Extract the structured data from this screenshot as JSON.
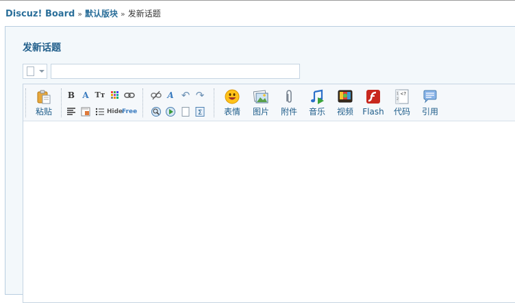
{
  "breadcrumb": {
    "home": "Discuz! Board",
    "separator": "»",
    "forum": "默认版块",
    "current": "发新话题"
  },
  "page": {
    "title": "发新话题"
  },
  "form": {
    "subject_placeholder": "",
    "subject_value": ""
  },
  "toolbar": {
    "paste_label": "粘贴",
    "hide_label": "Hide",
    "free_label": "Free",
    "smilies_label": "表情",
    "image_label": "图片",
    "attach_label": "附件",
    "audio_label": "音乐",
    "video_label": "视频",
    "flash_label": "Flash",
    "code_label": "代码",
    "quote_label": "引用"
  },
  "colors": {
    "link": "#2b6f9a",
    "title": "#1f5d8a",
    "panel_bg": "#f3f8fb",
    "border": "#c5d4e2"
  }
}
